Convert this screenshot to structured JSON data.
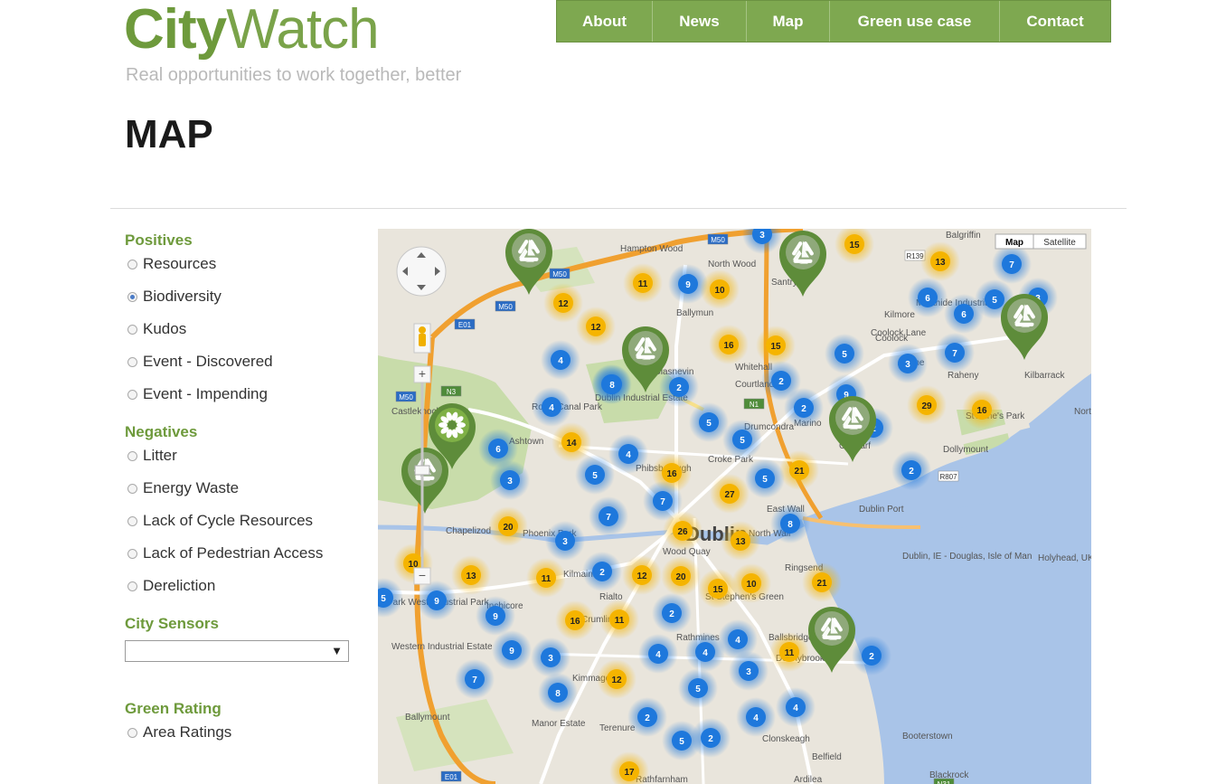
{
  "brand": {
    "name_bold": "City",
    "name_light": "Watch",
    "tagline": "Real opportunities to work together, better"
  },
  "nav": [
    "About",
    "News",
    "Map",
    "Green use case",
    "Contact"
  ],
  "page_title": "MAP",
  "sidebar": {
    "positives": {
      "title": "Positives",
      "items": [
        "Resources",
        "Biodiversity",
        "Kudos",
        "Event - Discovered",
        "Event - Impending"
      ],
      "selected": "Biodiversity"
    },
    "negatives": {
      "title": "Negatives",
      "items": [
        "Litter",
        "Energy Waste",
        "Lack of Cycle Resources",
        "Lack of Pedestrian Access",
        "Dereliction"
      ]
    },
    "sensors": {
      "title": "City Sensors",
      "value": ""
    },
    "rating": {
      "title": "Green Rating",
      "items": [
        "Area Ratings"
      ]
    }
  },
  "map": {
    "type_buttons": [
      "Map",
      "Satellite"
    ],
    "active_type": "Map",
    "zoom_in": "+",
    "zoom_out": "−",
    "colors": {
      "water": "#a9c4e8",
      "land": "#e9e5dc",
      "park": "#c8dcaa",
      "motorway": "#f0a030",
      "road": "#ffffff",
      "cluster_blue": "#1e78dc",
      "cluster_yellow": "#f5b400",
      "pin_green": "#5e8c3a"
    },
    "place_labels": [
      "Balgriffin",
      "Hampton Wood",
      "North Wood",
      "Santry",
      "Ballymun",
      "Kilmore",
      "Coolock",
      "Artane",
      "Raheny",
      "Kilbarrack",
      "Malahide Industrial",
      "Whitehall",
      "Courtlands",
      "Glasnevin",
      "Marino",
      "Clontarf",
      "Dollymount",
      "Royal Canal Park",
      "Dublin Industrial Estate",
      "Ashtown",
      "Castleknock",
      "Croke Park",
      "Phibsborough",
      "Drumcondra",
      "East Wall",
      "Dublin Port",
      "Chapelizod",
      "Phoenix Park",
      "Dublin",
      "North Wall",
      "Wood Quay",
      "Kilmainham",
      "Rialto",
      "Inchicore",
      "Ringsend",
      "St Stephen's Green",
      "Ballsbridge",
      "Park West Industrial Park",
      "Crumlin",
      "Rathmines",
      "Western Industrial Estate",
      "Kimmage",
      "Donnybrook",
      "Ballymount",
      "Manor Estate",
      "Terenure",
      "Clonskeagh",
      "Belfield",
      "Booterstown",
      "Blackrock",
      "Ardilea",
      "Rathfarnham",
      "Dublin, IE - Douglas, Isle of Man",
      "Holyhead, UK",
      "North Bull Island",
      "St Anne's Park",
      "Coolock Lane"
    ],
    "road_shields": [
      "M50",
      "M50",
      "M50",
      "E01",
      "N3",
      "N1",
      "R139",
      "R807",
      "M50",
      "E01",
      "N31"
    ],
    "clusters": [
      {
        "n": 3,
        "c": "blue"
      },
      {
        "n": 15,
        "c": "yellow"
      },
      {
        "n": 13,
        "c": "yellow"
      },
      {
        "n": 7,
        "c": "blue"
      },
      {
        "n": 11,
        "c": "yellow"
      },
      {
        "n": 9,
        "c": "blue"
      },
      {
        "n": 10,
        "c": "yellow"
      },
      {
        "n": 12,
        "c": "yellow"
      },
      {
        "n": 12,
        "c": "yellow"
      },
      {
        "n": 11,
        "c": "yellow"
      },
      {
        "n": 6,
        "c": "blue"
      },
      {
        "n": 6,
        "c": "blue"
      },
      {
        "n": 5,
        "c": "blue"
      },
      {
        "n": 3,
        "c": "blue"
      },
      {
        "n": 4,
        "c": "blue"
      },
      {
        "n": 16,
        "c": "yellow"
      },
      {
        "n": 15,
        "c": "yellow"
      },
      {
        "n": 5,
        "c": "blue"
      },
      {
        "n": 3,
        "c": "blue"
      },
      {
        "n": 7,
        "c": "blue"
      },
      {
        "n": 6,
        "c": "blue"
      },
      {
        "n": 4,
        "c": "blue"
      },
      {
        "n": 8,
        "c": "blue"
      },
      {
        "n": 2,
        "c": "blue"
      },
      {
        "n": 2,
        "c": "blue"
      },
      {
        "n": 2,
        "c": "blue"
      },
      {
        "n": 9,
        "c": "blue"
      },
      {
        "n": 2,
        "c": "blue"
      },
      {
        "n": 29,
        "c": "yellow"
      },
      {
        "n": 16,
        "c": "yellow"
      },
      {
        "n": 5,
        "c": "blue"
      },
      {
        "n": 5,
        "c": "blue"
      },
      {
        "n": 6,
        "c": "blue"
      },
      {
        "n": 14,
        "c": "yellow"
      },
      {
        "n": 4,
        "c": "blue"
      },
      {
        "n": 3,
        "c": "blue"
      },
      {
        "n": 5,
        "c": "blue"
      },
      {
        "n": 16,
        "c": "yellow"
      },
      {
        "n": 21,
        "c": "yellow"
      },
      {
        "n": 5,
        "c": "blue"
      },
      {
        "n": 2,
        "c": "blue"
      },
      {
        "n": 27,
        "c": "yellow"
      },
      {
        "n": 7,
        "c": "blue"
      },
      {
        "n": 7,
        "c": "blue"
      },
      {
        "n": 20,
        "c": "yellow"
      },
      {
        "n": 26,
        "c": "yellow"
      },
      {
        "n": 8,
        "c": "blue"
      },
      {
        "n": 13,
        "c": "yellow"
      },
      {
        "n": 3,
        "c": "blue"
      },
      {
        "n": 10,
        "c": "yellow"
      },
      {
        "n": 13,
        "c": "yellow"
      },
      {
        "n": 11,
        "c": "yellow"
      },
      {
        "n": 2,
        "c": "blue"
      },
      {
        "n": 12,
        "c": "yellow"
      },
      {
        "n": 20,
        "c": "yellow"
      },
      {
        "n": 15,
        "c": "yellow"
      },
      {
        "n": 10,
        "c": "yellow"
      },
      {
        "n": 21,
        "c": "yellow"
      },
      {
        "n": 5,
        "c": "blue"
      },
      {
        "n": 9,
        "c": "blue"
      },
      {
        "n": 9,
        "c": "blue"
      },
      {
        "n": 16,
        "c": "yellow"
      },
      {
        "n": 11,
        "c": "yellow"
      },
      {
        "n": 2,
        "c": "blue"
      },
      {
        "n": 2,
        "c": "blue"
      },
      {
        "n": 4,
        "c": "blue"
      },
      {
        "n": 9,
        "c": "blue"
      },
      {
        "n": 3,
        "c": "blue"
      },
      {
        "n": 4,
        "c": "blue"
      },
      {
        "n": 4,
        "c": "blue"
      },
      {
        "n": 11,
        "c": "yellow"
      },
      {
        "n": 2,
        "c": "blue"
      },
      {
        "n": 7,
        "c": "blue"
      },
      {
        "n": 8,
        "c": "blue"
      },
      {
        "n": 12,
        "c": "yellow"
      },
      {
        "n": 3,
        "c": "blue"
      },
      {
        "n": 5,
        "c": "blue"
      },
      {
        "n": 2,
        "c": "blue"
      },
      {
        "n": 4,
        "c": "blue"
      },
      {
        "n": 4,
        "c": "blue"
      },
      {
        "n": 5,
        "c": "blue"
      },
      {
        "n": 2,
        "c": "blue"
      },
      {
        "n": 17,
        "c": "yellow"
      }
    ],
    "pins": [
      {
        "icon": "recycle-pin-icon"
      },
      {
        "icon": "recycle-pin-icon"
      },
      {
        "icon": "biodiversity-pin-icon"
      },
      {
        "icon": "flower-pin-icon"
      },
      {
        "icon": "recycle-pin-icon"
      },
      {
        "icon": "recycle-pin-icon"
      },
      {
        "icon": "recycle-pin-icon"
      },
      {
        "icon": "recycle-pin-icon"
      }
    ]
  }
}
